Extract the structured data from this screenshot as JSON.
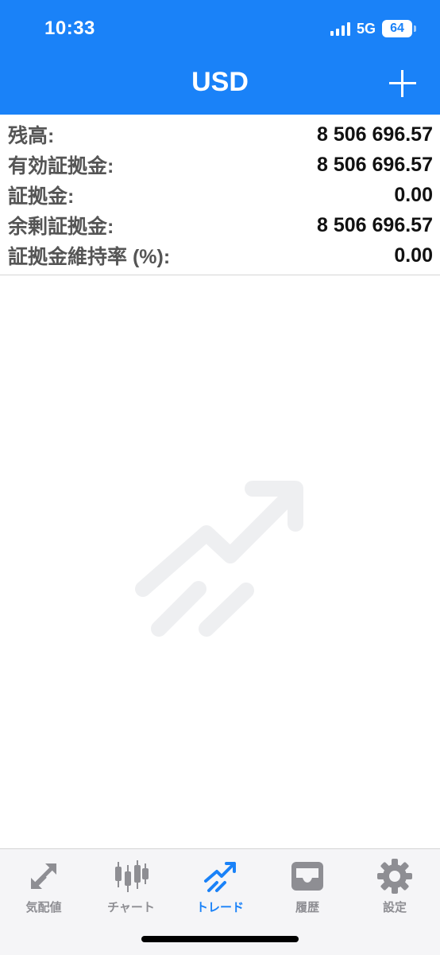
{
  "status_bar": {
    "time": "10:33",
    "network": "5G",
    "battery": "64",
    "battery_level": 0.64
  },
  "header": {
    "title": "USD",
    "add_icon": "plus-icon"
  },
  "summary": {
    "rows": [
      {
        "label": "残高:",
        "value": "8 506 696.57"
      },
      {
        "label": "有効証拠金:",
        "value": "8 506 696.57"
      },
      {
        "label": "証拠金:",
        "value": "0.00"
      },
      {
        "label": "余剰証拠金:",
        "value": "8 506 696.57"
      },
      {
        "label": "証拠金維持率 (%):",
        "value": "0.00"
      }
    ]
  },
  "empty_state": {
    "icon": "trade-trend-icon"
  },
  "tabbar": {
    "tabs": [
      {
        "label": "気配値",
        "icon": "quotes-arrows-icon",
        "active": false
      },
      {
        "label": "チャート",
        "icon": "candlestick-icon",
        "active": false
      },
      {
        "label": "トレード",
        "icon": "trade-icon",
        "active": true
      },
      {
        "label": "履歴",
        "icon": "history-tray-icon",
        "active": false
      },
      {
        "label": "設定",
        "icon": "gear-icon",
        "active": false
      }
    ]
  },
  "colors": {
    "accent": "#1a82f8",
    "inactive": "#8e8e93",
    "placeholder_icon": "#eeeff1"
  }
}
